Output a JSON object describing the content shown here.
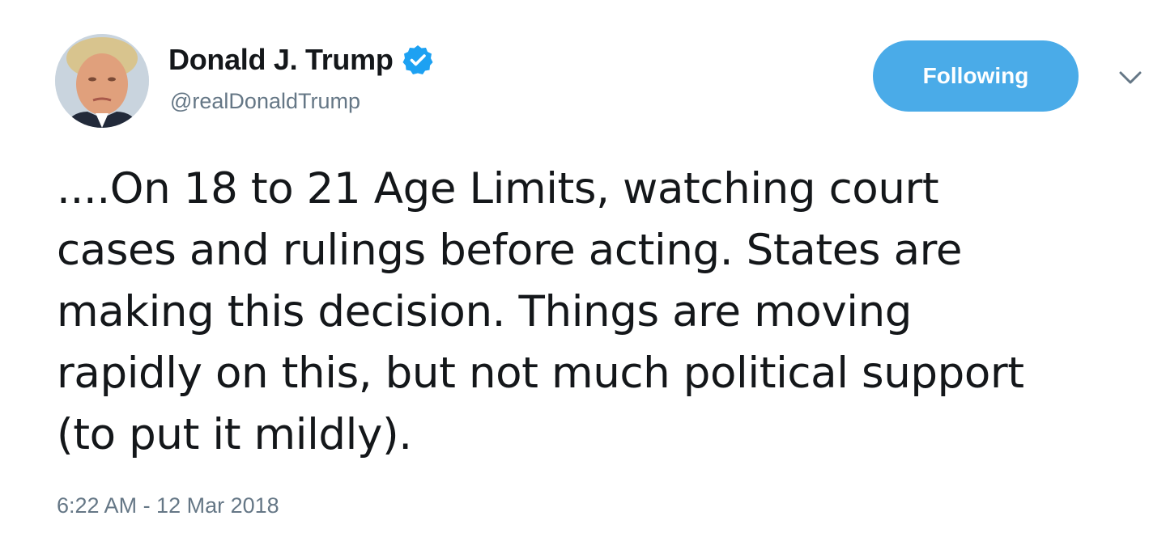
{
  "tweet": {
    "author": {
      "display_name": "Donald J. Trump",
      "handle": "@realDonaldTrump",
      "verified": true,
      "avatar_icon": "profile-photo"
    },
    "follow_button": {
      "label": "Following",
      "color": "#4aabe8"
    },
    "menu_icon": "chevron-down-icon",
    "text_lines": [
      "....On 18 to 21 Age Limits, watching court",
      "cases and rulings before acting. States are",
      "making this decision. Things are moving",
      "rapidly on this, but not much political support",
      "(to put it mildly)."
    ],
    "timestamp": "6:22 AM - 12 Mar 2018"
  },
  "colors": {
    "text_primary": "#14171a",
    "text_secondary": "#657786",
    "verified_badge": "#1da1f2"
  }
}
